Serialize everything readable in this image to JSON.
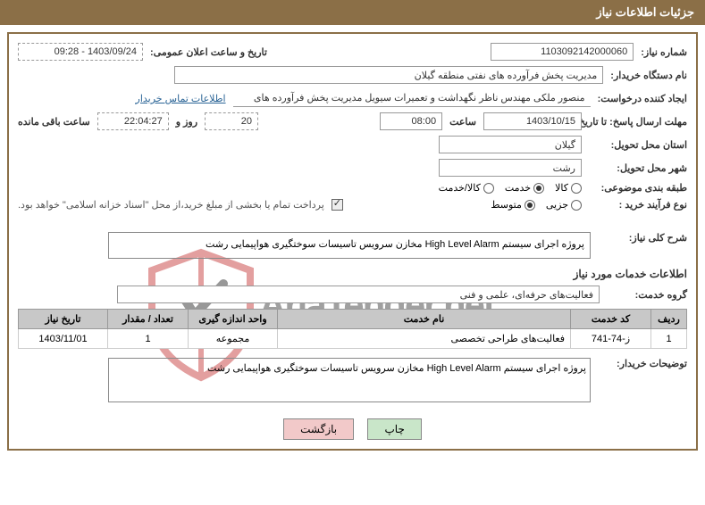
{
  "header": {
    "title": "جزئیات اطلاعات نیاز"
  },
  "labels": {
    "need_no": "شماره نیاز:",
    "announce_dt": "تاریخ و ساعت اعلان عمومی:",
    "buyer_org": "نام دستگاه خریدار:",
    "requester": "ایجاد کننده درخواست:",
    "contact_link": "اطلاعات تماس خریدار",
    "reply_deadline": "مهلت ارسال پاسخ: تا تاریخ:",
    "hour": "ساعت",
    "days_and": "روز و",
    "time_left": "ساعت باقی مانده",
    "delivery_province": "استان محل تحویل:",
    "delivery_city": "شهر محل تحویل:",
    "subject_class": "طبقه بندی موضوعی:",
    "purchase_type": "نوع فرآیند خرید :",
    "need_summary": "شرح کلی نیاز:",
    "services_info": "اطلاعات خدمات مورد نیاز",
    "service_group": "گروه خدمت:",
    "buyer_notes": "توضیحات خریدار:"
  },
  "radios": {
    "goods": "کالا",
    "service": "خدمت",
    "goods_service": "کالا/خدمت",
    "minor": "جزیی",
    "medium": "متوسط"
  },
  "payment_note": "پرداخت تمام یا بخشی از مبلغ خرید،از محل \"اسناد خزانه اسلامی\" خواهد بود.",
  "values": {
    "need_no": "1103092142000060",
    "announce_dt": "1403/09/24 - 09:28",
    "buyer_org": "مدیریت پخش فرآورده های نفتی منطقه گیلان",
    "requester": "منصور ملکی مهندس ناظر نگهداشت و تعمیرات سیویل مدیریت پخش فرآورده های",
    "deadline_date": "1403/10/15",
    "deadline_hour": "08:00",
    "days_left": "20",
    "time_left": "22:04:27",
    "province": "گیلان",
    "city": "رشت",
    "need_desc": "پروژه اجرای سیستم High Level Alarm مخازن سرویس تاسیسات سوختگیری هواپیمایی رشت",
    "service_group": "فعالیت‌های حرفه‌ای، علمی و فنی",
    "buyer_notes": "پروژه اجرای سیستم High Level Alarm مخازن سرویس تاسیسات سوختگیری هواپیمایی رشت"
  },
  "table": {
    "headers": {
      "row": "ردیف",
      "code": "کد خدمت",
      "name": "نام خدمت",
      "unit": "واحد اندازه گیری",
      "qty": "تعداد / مقدار",
      "need_date": "تاریخ نیاز"
    },
    "row1": {
      "idx": "1",
      "code": "ز-74-741",
      "name": "فعالیت‌های طراحی تخصصی",
      "unit": "مجموعه",
      "qty": "1",
      "need_date": "1403/11/01"
    }
  },
  "buttons": {
    "print": "چاپ",
    "back": "بازگشت"
  },
  "watermark": "AriaTender.net"
}
